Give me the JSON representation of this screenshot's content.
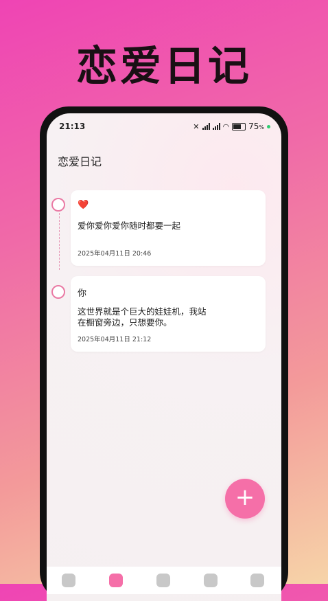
{
  "promo": {
    "title": "恋爱日记"
  },
  "status_bar": {
    "time": "21:13",
    "battery_percent": "75",
    "battery_unit": "%"
  },
  "page": {
    "title": "恋爱日记"
  },
  "entries": [
    {
      "title": "❤️",
      "text": "爱你爱你爱你随时都要一起",
      "date": "2025年04月11日 20:46"
    },
    {
      "title": "你",
      "text": "这世界就是个巨大的娃娃机，我站\n在橱窗旁边，只想要你。",
      "date": "2025年04月11日 21:12"
    }
  ],
  "fab": {
    "label": "+"
  },
  "tabbar": {
    "items": [
      "home-icon",
      "diary-icon",
      "album-icon",
      "message-icon",
      "profile-icon"
    ],
    "active_index": 1
  },
  "colors": {
    "accent": "#f56fa8",
    "timeline": "#ea7aa4"
  }
}
